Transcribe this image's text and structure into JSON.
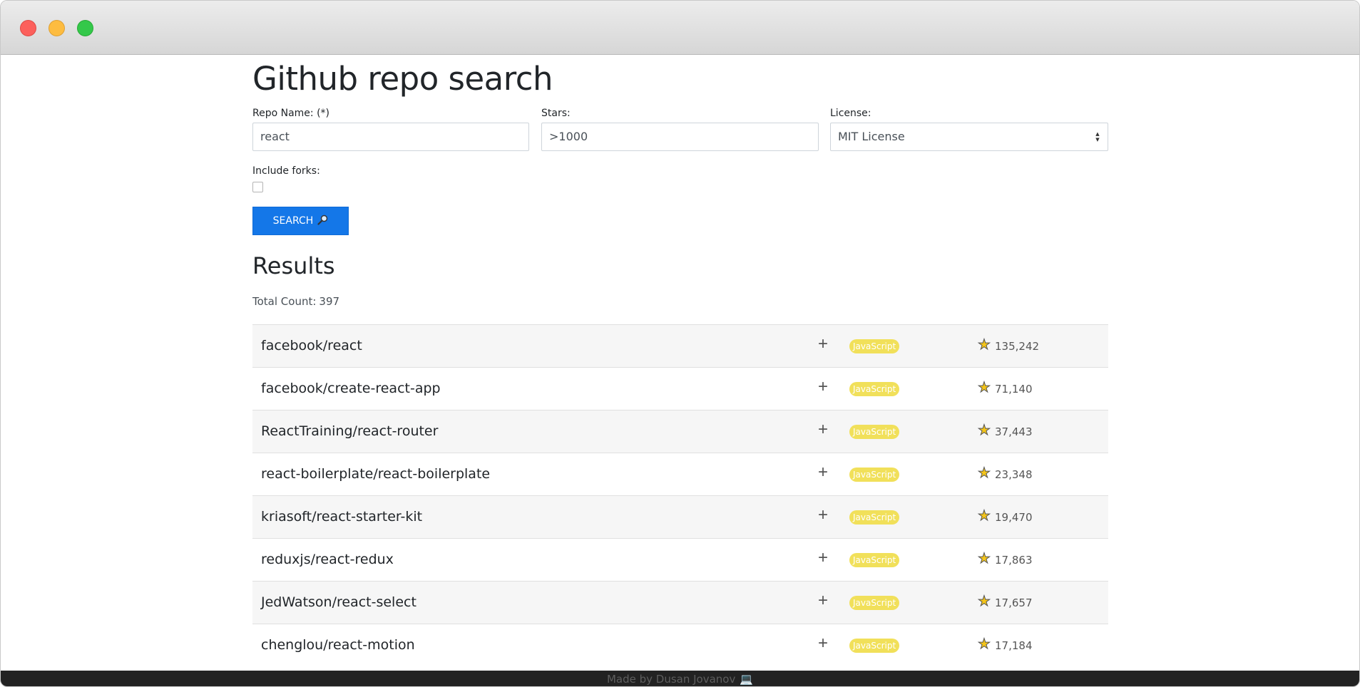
{
  "page": {
    "title": "Github repo search"
  },
  "form": {
    "repo_name_label": "Repo Name: (*)",
    "repo_name_value": "react",
    "stars_label": "Stars:",
    "stars_value": ">1000",
    "license_label": "License:",
    "license_value": "MIT License",
    "forks_label": "Include forks:",
    "forks_checked": false,
    "search_button": "SEARCH",
    "search_icon": "magnifier-icon"
  },
  "results": {
    "title": "Results",
    "total_label": "Total Count:",
    "total_count": "397",
    "items": [
      {
        "name": "facebook/react",
        "language": "JavaScript",
        "stars": "135,242"
      },
      {
        "name": "facebook/create-react-app",
        "language": "JavaScript",
        "stars": "71,140"
      },
      {
        "name": "ReactTraining/react-router",
        "language": "JavaScript",
        "stars": "37,443"
      },
      {
        "name": "react-boilerplate/react-boilerplate",
        "language": "JavaScript",
        "stars": "23,348"
      },
      {
        "name": "kriasoft/react-starter-kit",
        "language": "JavaScript",
        "stars": "19,470"
      },
      {
        "name": "reduxjs/react-redux",
        "language": "JavaScript",
        "stars": "17,863"
      },
      {
        "name": "JedWatson/react-select",
        "language": "JavaScript",
        "stars": "17,657"
      },
      {
        "name": "chenglou/react-motion",
        "language": "JavaScript",
        "stars": "17,184"
      }
    ]
  },
  "footer": {
    "text": "Made by Dusan Jovanov",
    "icon": "laptop-icon"
  },
  "colors": {
    "search_button": "#1477e8",
    "language_badge": "#f1e05a",
    "star": "#f5c518"
  }
}
